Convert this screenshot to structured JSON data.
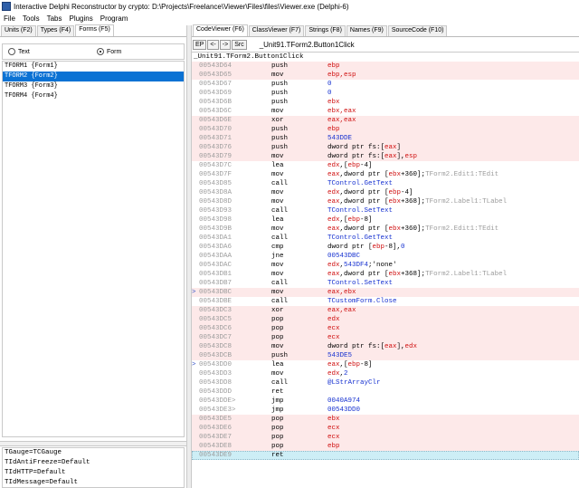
{
  "window": {
    "title": "Interactive Delphi Reconstructor by crypto: D:\\Projects\\Freelance\\Viewer\\Files\\files\\Viewer.exe (Delphi-6)"
  },
  "menu": [
    "File",
    "Tools",
    "Tabs",
    "Plugins",
    "Program"
  ],
  "left_panel": {
    "tabs": [
      {
        "label": "Units (F2)",
        "active": false
      },
      {
        "label": "Types (F4)",
        "active": false
      },
      {
        "label": "Forms (F5)",
        "active": true
      }
    ],
    "radio": [
      {
        "label": "Text",
        "checked": false
      },
      {
        "label": "Form",
        "checked": true
      }
    ],
    "forms": [
      {
        "text": "TFORM1 {Form1}",
        "selected": false
      },
      {
        "text": "TFORM2 {Form2}",
        "selected": true
      },
      {
        "text": "TFORM3 {Form3}",
        "selected": false
      },
      {
        "text": "TFORM4 {Form4}",
        "selected": false
      }
    ],
    "components": [
      "TGauge=TCGauge",
      "TIdAntiFreeze=Default",
      "TIdHTTP=Default",
      "TIdMessage=Default"
    ]
  },
  "right_panel": {
    "tabs": [
      {
        "label": "CodeViewer (F6)",
        "active": true
      },
      {
        "label": "ClassViewer (F7)",
        "active": false
      },
      {
        "label": "Strings (F8)",
        "active": false
      },
      {
        "label": "Names (F9)",
        "active": false
      },
      {
        "label": "SourceCode (F10)",
        "active": false
      }
    ],
    "toolbar": {
      "buttons": [
        "EP",
        "<-",
        "->",
        "Src"
      ],
      "proc_name": "_Unit91.TForm2.Button1Click"
    },
    "code_header": "_Unit91.TForm2.Button1Click",
    "code_lines": [
      {
        "marker": "",
        "addr": "00543D64",
        "mn": "push",
        "hl": true,
        "op": [
          {
            "t": "ebp",
            "c": "reg"
          }
        ]
      },
      {
        "marker": "",
        "addr": "00543D65",
        "mn": "mov",
        "hl": true,
        "op": [
          {
            "t": "ebp,esp",
            "c": "reg"
          }
        ]
      },
      {
        "marker": "",
        "addr": "00543D67",
        "mn": "push",
        "hl": false,
        "op": [
          {
            "t": "0",
            "c": "num"
          }
        ]
      },
      {
        "marker": "",
        "addr": "00543D69",
        "mn": "push",
        "hl": false,
        "op": [
          {
            "t": "0",
            "c": "num"
          }
        ]
      },
      {
        "marker": "",
        "addr": "00543D6B",
        "mn": "push",
        "hl": false,
        "op": [
          {
            "t": "ebx",
            "c": "reg"
          }
        ]
      },
      {
        "marker": "",
        "addr": "00543D6C",
        "mn": "mov",
        "hl": false,
        "op": [
          {
            "t": "ebx,eax",
            "c": "reg"
          }
        ]
      },
      {
        "marker": "",
        "addr": "00543D6E",
        "mn": "xor",
        "hl": true,
        "op": [
          {
            "t": "eax,eax",
            "c": "reg"
          }
        ]
      },
      {
        "marker": "",
        "addr": "00543D70",
        "mn": "push",
        "hl": true,
        "op": [
          {
            "t": "ebp",
            "c": "reg"
          }
        ]
      },
      {
        "marker": "",
        "addr": "00543D71",
        "mn": "push",
        "hl": true,
        "op": [
          {
            "t": "543DDE",
            "c": "num"
          }
        ]
      },
      {
        "marker": "",
        "addr": "00543D76",
        "mn": "push",
        "hl": true,
        "op": [
          {
            "t": "dword ptr fs:[",
            "c": "txt"
          },
          {
            "t": "eax",
            "c": "reg"
          },
          {
            "t": "]",
            "c": "txt"
          }
        ]
      },
      {
        "marker": "",
        "addr": "00543D79",
        "mn": "mov",
        "hl": true,
        "op": [
          {
            "t": "dword ptr fs:[",
            "c": "txt"
          },
          {
            "t": "eax",
            "c": "reg"
          },
          {
            "t": "],",
            "c": "txt"
          },
          {
            "t": "esp",
            "c": "reg"
          }
        ]
      },
      {
        "marker": "",
        "addr": "00543D7C",
        "mn": "lea",
        "hl": false,
        "op": [
          {
            "t": "edx",
            "c": "reg"
          },
          {
            "t": ",[",
            "c": "txt"
          },
          {
            "t": "ebp",
            "c": "reg"
          },
          {
            "t": "-4]",
            "c": "txt"
          }
        ]
      },
      {
        "marker": "",
        "addr": "00543D7F",
        "mn": "mov",
        "hl": false,
        "op": [
          {
            "t": "eax",
            "c": "reg"
          },
          {
            "t": ",dword ptr [",
            "c": "txt"
          },
          {
            "t": "ebx",
            "c": "reg"
          },
          {
            "t": "+360];",
            "c": "txt"
          },
          {
            "t": "TForm2.Edit1:TEdit",
            "c": "cmt"
          }
        ]
      },
      {
        "marker": "",
        "addr": "00543D85",
        "mn": "call",
        "hl": false,
        "op": [
          {
            "t": "TControl.GetText",
            "c": "sym"
          }
        ]
      },
      {
        "marker": "",
        "addr": "00543D8A",
        "mn": "mov",
        "hl": false,
        "op": [
          {
            "t": "edx",
            "c": "reg"
          },
          {
            "t": ",dword ptr [",
            "c": "txt"
          },
          {
            "t": "ebp",
            "c": "reg"
          },
          {
            "t": "-4]",
            "c": "txt"
          }
        ]
      },
      {
        "marker": "",
        "addr": "00543D8D",
        "mn": "mov",
        "hl": false,
        "op": [
          {
            "t": "eax",
            "c": "reg"
          },
          {
            "t": ",dword ptr [",
            "c": "txt"
          },
          {
            "t": "ebx",
            "c": "reg"
          },
          {
            "t": "+368];",
            "c": "txt"
          },
          {
            "t": "TForm2.Label1:TLabel",
            "c": "cmt"
          }
        ]
      },
      {
        "marker": "",
        "addr": "00543D93",
        "mn": "call",
        "hl": false,
        "op": [
          {
            "t": "TControl.SetText",
            "c": "sym"
          }
        ]
      },
      {
        "marker": "",
        "addr": "00543D98",
        "mn": "lea",
        "hl": false,
        "op": [
          {
            "t": "edx",
            "c": "reg"
          },
          {
            "t": ",[",
            "c": "txt"
          },
          {
            "t": "ebp",
            "c": "reg"
          },
          {
            "t": "-8]",
            "c": "txt"
          }
        ]
      },
      {
        "marker": "",
        "addr": "00543D9B",
        "mn": "mov",
        "hl": false,
        "op": [
          {
            "t": "eax",
            "c": "reg"
          },
          {
            "t": ",dword ptr [",
            "c": "txt"
          },
          {
            "t": "ebx",
            "c": "reg"
          },
          {
            "t": "+360];",
            "c": "txt"
          },
          {
            "t": "TForm2.Edit1:TEdit",
            "c": "cmt"
          }
        ]
      },
      {
        "marker": "",
        "addr": "00543DA1",
        "mn": "call",
        "hl": false,
        "op": [
          {
            "t": "TControl.GetText",
            "c": "sym"
          }
        ]
      },
      {
        "marker": "",
        "addr": "00543DA6",
        "mn": "cmp",
        "hl": false,
        "op": [
          {
            "t": "dword ptr [",
            "c": "txt"
          },
          {
            "t": "ebp",
            "c": "reg"
          },
          {
            "t": "-8],",
            "c": "txt"
          },
          {
            "t": "0",
            "c": "num"
          }
        ]
      },
      {
        "marker": "",
        "addr": "00543DAA",
        "mn": "jne",
        "hl": false,
        "op": [
          {
            "t": "00543DBC",
            "c": "num"
          }
        ]
      },
      {
        "marker": "",
        "addr": "00543DAC",
        "mn": "mov",
        "hl": false,
        "op": [
          {
            "t": "edx",
            "c": "reg"
          },
          {
            "t": ",",
            "c": "txt"
          },
          {
            "t": "543DF4",
            "c": "num"
          },
          {
            "t": ";'none'",
            "c": "txt"
          }
        ]
      },
      {
        "marker": "",
        "addr": "00543DB1",
        "mn": "mov",
        "hl": false,
        "op": [
          {
            "t": "eax",
            "c": "reg"
          },
          {
            "t": ",dword ptr [",
            "c": "txt"
          },
          {
            "t": "ebx",
            "c": "reg"
          },
          {
            "t": "+368];",
            "c": "txt"
          },
          {
            "t": "TForm2.Label1:TLabel",
            "c": "cmt"
          }
        ]
      },
      {
        "marker": "",
        "addr": "00543DB7",
        "mn": "call",
        "hl": false,
        "op": [
          {
            "t": "TControl.SetText",
            "c": "sym"
          }
        ]
      },
      {
        "marker": ">",
        "addr": "00543DBC",
        "mn": "mov",
        "hl": true,
        "op": [
          {
            "t": "eax,ebx",
            "c": "reg"
          }
        ]
      },
      {
        "marker": "",
        "addr": "00543DBE",
        "mn": "call",
        "hl": false,
        "op": [
          {
            "t": "TCustomForm.Close",
            "c": "sym"
          }
        ]
      },
      {
        "marker": "",
        "addr": "00543DC3",
        "mn": "xor",
        "hl": true,
        "op": [
          {
            "t": "eax,eax",
            "c": "reg"
          }
        ]
      },
      {
        "marker": "",
        "addr": "00543DC5",
        "mn": "pop",
        "hl": true,
        "op": [
          {
            "t": "edx",
            "c": "reg"
          }
        ]
      },
      {
        "marker": "",
        "addr": "00543DC6",
        "mn": "pop",
        "hl": true,
        "op": [
          {
            "t": "ecx",
            "c": "reg"
          }
        ]
      },
      {
        "marker": "",
        "addr": "00543DC7",
        "mn": "pop",
        "hl": true,
        "op": [
          {
            "t": "ecx",
            "c": "reg"
          }
        ]
      },
      {
        "marker": "",
        "addr": "00543DC8",
        "mn": "mov",
        "hl": true,
        "op": [
          {
            "t": "dword ptr fs:[",
            "c": "txt"
          },
          {
            "t": "eax",
            "c": "reg"
          },
          {
            "t": "],",
            "c": "txt"
          },
          {
            "t": "edx",
            "c": "reg"
          }
        ]
      },
      {
        "marker": "",
        "addr": "00543DCB",
        "mn": "push",
        "hl": true,
        "op": [
          {
            "t": "543DE5",
            "c": "num"
          }
        ]
      },
      {
        "marker": ">",
        "addr": "00543DD0",
        "mn": "lea",
        "hl": false,
        "op": [
          {
            "t": "eax",
            "c": "reg"
          },
          {
            "t": ",[",
            "c": "txt"
          },
          {
            "t": "ebp",
            "c": "reg"
          },
          {
            "t": "-8]",
            "c": "txt"
          }
        ]
      },
      {
        "marker": "",
        "addr": "00543DD3",
        "mn": "mov",
        "hl": false,
        "op": [
          {
            "t": "edx",
            "c": "reg"
          },
          {
            "t": ",",
            "c": "txt"
          },
          {
            "t": "2",
            "c": "num"
          }
        ]
      },
      {
        "marker": "",
        "addr": "00543DD8",
        "mn": "call",
        "hl": false,
        "op": [
          {
            "t": "@LStrArrayClr",
            "c": "sym"
          }
        ]
      },
      {
        "marker": "",
        "addr": "00543DDD",
        "mn": "ret",
        "hl": false,
        "op": []
      },
      {
        "marker": "",
        "addr": "00543DDE>",
        "mn": "jmp",
        "hl": false,
        "op": [
          {
            "t": "0040A974",
            "c": "num"
          }
        ]
      },
      {
        "marker": "",
        "addr": "00543DE3>",
        "mn": "jmp",
        "hl": false,
        "op": [
          {
            "t": "00543DD0",
            "c": "num"
          }
        ]
      },
      {
        "marker": "",
        "addr": "00543DE5",
        "mn": "pop",
        "hl": true,
        "op": [
          {
            "t": "ebx",
            "c": "reg"
          }
        ]
      },
      {
        "marker": "",
        "addr": "00543DE6",
        "mn": "pop",
        "hl": true,
        "op": [
          {
            "t": "ecx",
            "c": "reg"
          }
        ]
      },
      {
        "marker": "",
        "addr": "00543DE7",
        "mn": "pop",
        "hl": true,
        "op": [
          {
            "t": "ecx",
            "c": "reg"
          }
        ]
      },
      {
        "marker": "",
        "addr": "00543DE8",
        "mn": "pop",
        "hl": true,
        "op": [
          {
            "t": "ebp",
            "c": "reg"
          }
        ]
      },
      {
        "marker": "",
        "addr": "00543DE9",
        "mn": "ret",
        "hl": false,
        "current": true,
        "op": []
      }
    ]
  },
  "colors": {
    "register": "#d01010",
    "number": "#1530d0",
    "comment": "#9c9c9c",
    "row_highlight": "#fde9e9",
    "current_row": "#cdeef6",
    "selection": "#0a72d4"
  }
}
